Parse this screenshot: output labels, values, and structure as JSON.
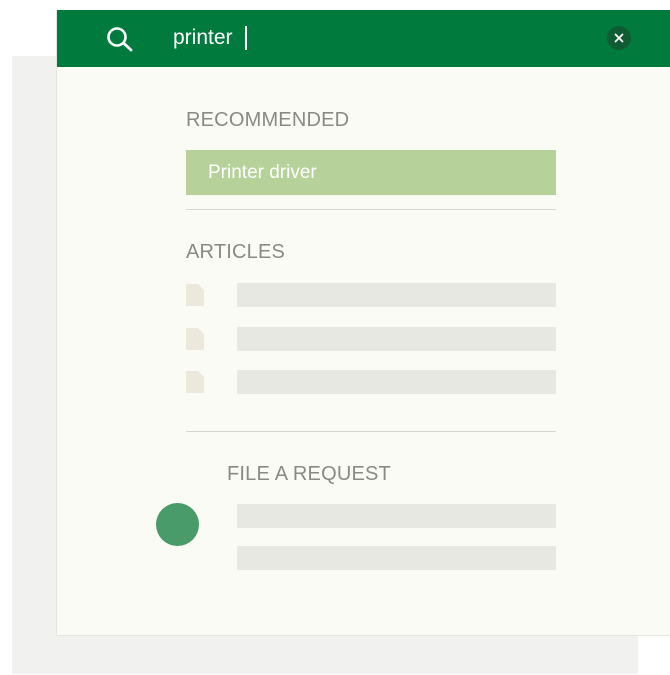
{
  "search": {
    "query": "printer",
    "clear_icon": "close-icon",
    "search_icon": "search-icon"
  },
  "recommended": {
    "heading": "RECOMMENDED",
    "items": [
      {
        "label": "Printer driver"
      }
    ]
  },
  "articles": {
    "heading": "ARTICLES",
    "item_icon": "document-icon"
  },
  "file_request": {
    "heading": "FILE A REQUEST"
  },
  "colors": {
    "header_green": "#007a3d",
    "highlight_green": "#b7d19a",
    "avatar_green": "#4a9b6a"
  }
}
